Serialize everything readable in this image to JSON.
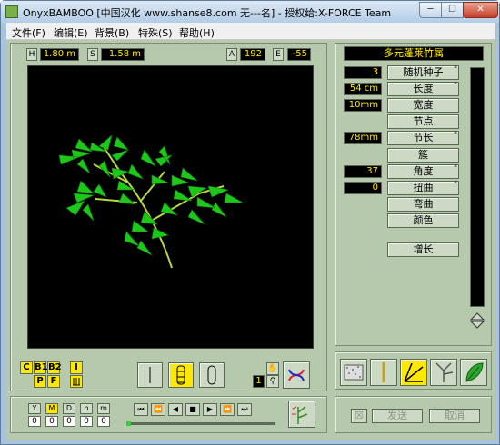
{
  "window": {
    "title": "OnyxBAMBOO [中国汉化 www.shanse8.com 无---名] - 授权给:X-FORCE Team",
    "minimize": "─",
    "maximize": "☐",
    "close": "✕"
  },
  "menu": [
    "文件(F)",
    "编辑(E)",
    "背景(B)",
    "特殊(S)",
    "帮助(H)"
  ],
  "top_fields": {
    "h_label": "H",
    "h_value": "1.80 m",
    "s_label": "S",
    "s_value": "1.58 m",
    "a_label": "A",
    "a_value": "192",
    "e_label": "E",
    "e_value": "-55"
  },
  "plant": {
    "name": "多元蓬莱竹属",
    "params": [
      {
        "value": "3",
        "label": "随机种子",
        "quote": "\""
      },
      {
        "value": "54 cm",
        "label": "长度",
        "quote": "\""
      },
      {
        "value": "10mm",
        "label": "宽度",
        "quote": ""
      },
      {
        "value": "",
        "label": "节点",
        "quote": ""
      },
      {
        "value": "78mm",
        "label": "节长",
        "quote": "\""
      },
      {
        "value": "",
        "label": "簇",
        "quote": ""
      },
      {
        "value": "37",
        "label": "角度",
        "quote": "\""
      },
      {
        "value": "0",
        "label": "扭曲",
        "quote": "\""
      },
      {
        "value": "",
        "label": "弯曲",
        "quote": ""
      },
      {
        "value": "",
        "label": "颜色",
        "quote": ""
      }
    ],
    "grow": "增长"
  },
  "bottom_left": {
    "labels": [
      "C",
      "B1",
      "B2",
      "P",
      "F"
    ],
    "i_label": "I",
    "counter": "1"
  },
  "timeline": {
    "labels": [
      "Y",
      "M",
      "D",
      "h",
      "m"
    ],
    "active": "M",
    "values": [
      "0",
      "0",
      "0",
      "0",
      "0"
    ]
  },
  "playback": [
    "⏮",
    "⏪",
    "◀",
    "■",
    "▶",
    "⏩",
    "⏭"
  ],
  "actions": {
    "send": "发送",
    "cancel": "取消",
    "send_icon": "☒"
  },
  "colors": {
    "client_bg": "#b7c9ad",
    "viewport": "#000000",
    "display_text": "#ffe800",
    "plant": "#8fdc1f"
  }
}
